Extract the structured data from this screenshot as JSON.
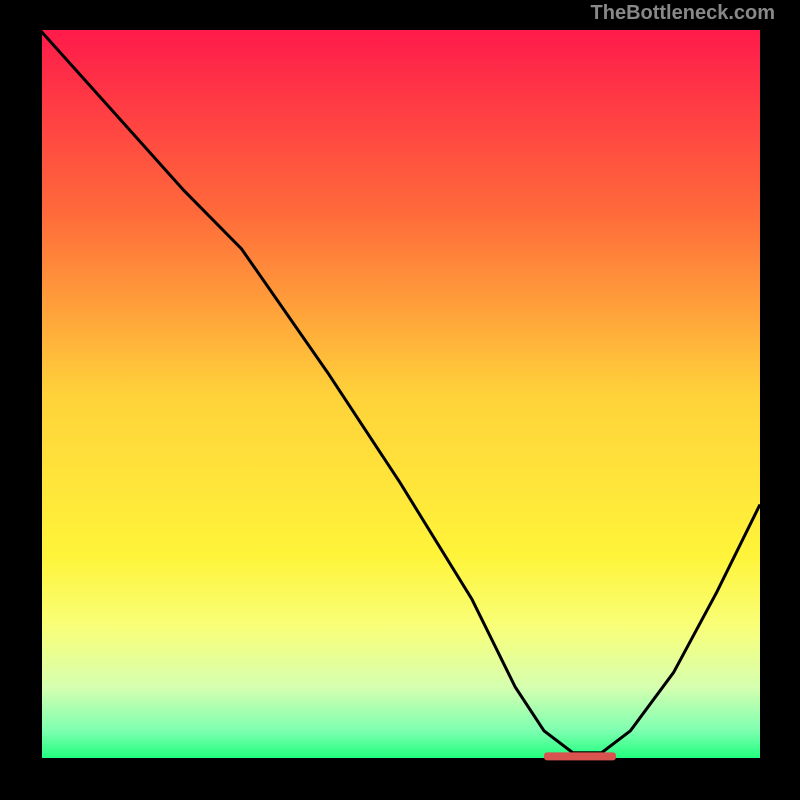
{
  "watermark": "TheBottleneck.com",
  "chart_data": {
    "type": "line",
    "title": "",
    "xlabel": "",
    "ylabel": "",
    "xlim": [
      0,
      100
    ],
    "ylim": [
      0,
      100
    ],
    "series": [
      {
        "name": "curve",
        "x": [
          0,
          10,
          20,
          28,
          40,
          50,
          60,
          66,
          70,
          74,
          78,
          82,
          88,
          94,
          100
        ],
        "y": [
          100,
          89,
          78,
          70,
          53,
          38,
          22,
          10,
          4,
          1,
          1,
          4,
          12,
          23,
          35
        ]
      }
    ],
    "marker": {
      "x_start": 70,
      "x_end": 80,
      "y": 0.5,
      "color": "#d9534f"
    },
    "gradient_stops": [
      {
        "offset": 0.0,
        "color": "#ff1a4b"
      },
      {
        "offset": 0.25,
        "color": "#ff6a3a"
      },
      {
        "offset": 0.5,
        "color": "#ffd23a"
      },
      {
        "offset": 0.72,
        "color": "#fff43a"
      },
      {
        "offset": 0.82,
        "color": "#f8ff7a"
      },
      {
        "offset": 0.9,
        "color": "#d6ffb0"
      },
      {
        "offset": 0.96,
        "color": "#7dffb0"
      },
      {
        "offset": 1.0,
        "color": "#1aff7a"
      }
    ],
    "axes_color": "#000000",
    "curve_color": "#000000"
  }
}
